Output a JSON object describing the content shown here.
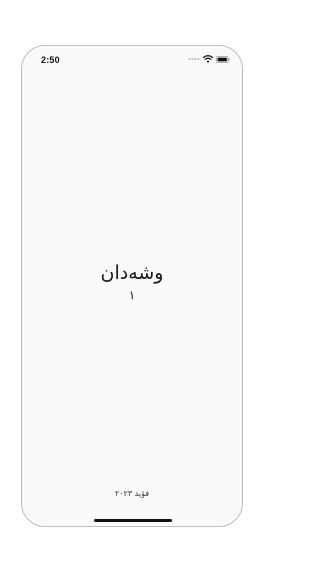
{
  "status_bar": {
    "time": "2:50",
    "icons": [
      "signal-dots-icon",
      "wifi-icon",
      "battery-icon"
    ]
  },
  "main": {
    "title": "وشەدان",
    "subtitle": "١"
  },
  "footer": {
    "text": "فۆید ٢٠٢٣"
  },
  "colors": {
    "background": "#fafafa",
    "text": "#1a1a1a",
    "frame": "#bdbdbd"
  }
}
